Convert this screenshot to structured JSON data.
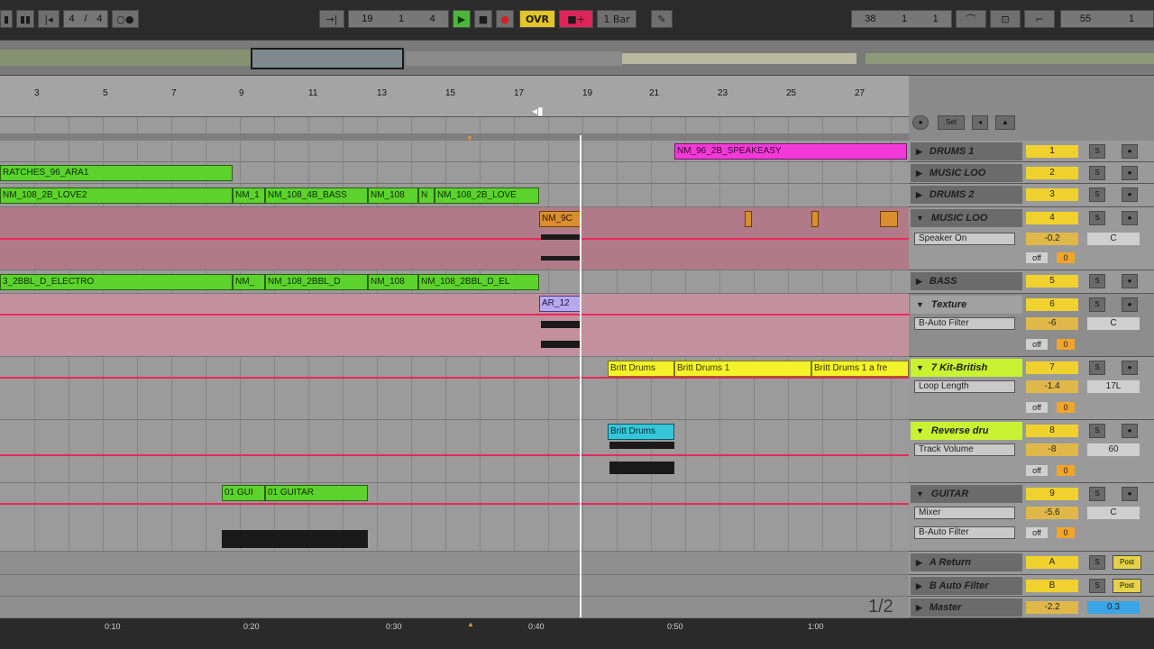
{
  "transport": {
    "tempo_start": "19",
    "tempo_mid": "1",
    "tempo_end": "4",
    "ovr_label": "OVR",
    "quant_label": "1 Bar",
    "pos_a": "38",
    "pos_b": "1",
    "pos_c": "1",
    "end_a": "55",
    "end_b": "1"
  },
  "ruler": {
    "bars": [
      "3",
      "5",
      "7",
      "9",
      "11",
      "13",
      "15",
      "17",
      "19",
      "21",
      "23",
      "25",
      "27"
    ],
    "times": [
      "0:10",
      "0:20",
      "0:30",
      "0:40",
      "0:50",
      "1:00"
    ]
  },
  "clips": {
    "speakeasy": "NM_96_2B_SPEAKEASY",
    "scratches": "RATCHES_96_ARA1",
    "loves_a": "NM_108_2B_LOVE2",
    "clip_short1": "NM_1",
    "bass48": "NM_108_4B_BASS",
    "nm108_a": "NM_108",
    "n": "N",
    "loves_b": "NM_108_2B_LOVE",
    "orange_small": "NM_9C",
    "electro_a": "3_2BBL_D_ELECTRO",
    "nm_short2": "NM_",
    "electro_b": "NM_108_2BBL_D",
    "nm108_b": "NM_108",
    "electro_c": "NM_108_2BBL_D_EL",
    "violet": "AR_12",
    "britt1": "Britt Drums",
    "britt2": "Britt Drums 1",
    "britt3": "Britt Drums 1 a fre",
    "cyan": "Britt Drums",
    "guitar_a": "01 GUI",
    "guitar_b": "01 GUITAR"
  },
  "tracks": [
    {
      "name": "DRUMS 1",
      "num": "1"
    },
    {
      "name": "MUSIC LOO",
      "num": "2"
    },
    {
      "name": "DRUMS 2",
      "num": "3"
    },
    {
      "name": "MUSIC LOO",
      "num": "4",
      "device": "Speaker On",
      "val": "-0.2",
      "val2": "C"
    },
    {
      "name": "BASS",
      "num": "5"
    },
    {
      "name": "Texture",
      "num": "6",
      "device": "B-Auto Filter",
      "val": "-6",
      "val2": "C"
    },
    {
      "name": "7 Kit-British",
      "num": "7",
      "device": "Loop Length",
      "val": "-1.4",
      "val2": "17L"
    },
    {
      "name": "Reverse dru",
      "num": "8",
      "device": "Track Volume",
      "val": "-8",
      "val2": "60"
    },
    {
      "name": "GUITAR",
      "num": "9",
      "device": "Mixer",
      "device2": "B-Auto Filter",
      "val": "-5.6",
      "val2": "C"
    },
    {
      "name": "A Return",
      "num": "A",
      "post": "Post"
    },
    {
      "name": "B Auto Filter",
      "num": "B",
      "post": "Post"
    },
    {
      "name": "Master",
      "num": "",
      "val": "-2.2",
      "val2": "0.3"
    }
  ],
  "misc": {
    "off": "off",
    "zero": "0",
    "page": "1/2",
    "set_label": "Set"
  }
}
